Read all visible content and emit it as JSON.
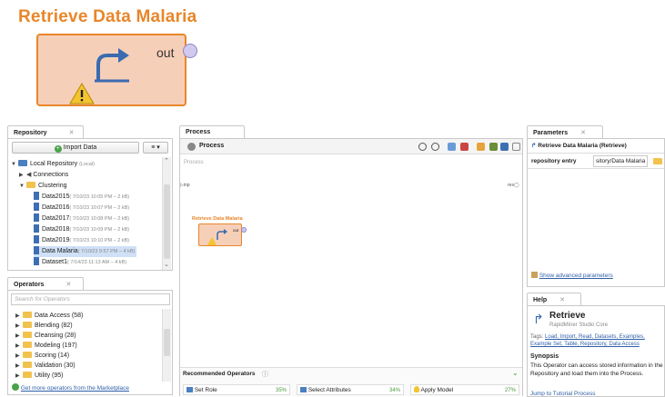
{
  "zoom": {
    "title": "Retrieve Data Malaria",
    "port_label": "out"
  },
  "repository": {
    "tab": "Repository",
    "import_button": "Import Data",
    "menu_button": "≡ ▾",
    "items": [
      {
        "label": "Local Repository",
        "meta": "(Local)",
        "kind": "root"
      },
      {
        "label": "Connections",
        "meta": "",
        "kind": "folder"
      },
      {
        "label": "Clustering",
        "meta": "",
        "kind": "folder"
      },
      {
        "label": "Data2015",
        "meta": "( 7/10/23 10:05 PM – 2 kB)",
        "kind": "data"
      },
      {
        "label": "Data2016",
        "meta": "( 7/10/23 10:07 PM – 2 kB)",
        "kind": "data"
      },
      {
        "label": "Data2017",
        "meta": "( 7/10/23 10:08 PM – 2 kB)",
        "kind": "data"
      },
      {
        "label": "Data2018",
        "meta": "( 7/10/23 10:09 PM – 2 kB)",
        "kind": "data"
      },
      {
        "label": "Data2019",
        "meta": "( 7/10/23 10:10 PM – 2 kB)",
        "kind": "data"
      },
      {
        "label": "Data Malaria",
        "meta": "( 7/10/23 9:57 PM – 4 kB)",
        "kind": "data"
      },
      {
        "label": "Dataset1",
        "meta": "( 7/14/23 11:13 AM – 4 kB)",
        "kind": "data"
      }
    ]
  },
  "operators": {
    "tab": "Operators",
    "search_placeholder": "Search for Operators",
    "items": [
      {
        "label": "Data Access (58)"
      },
      {
        "label": "Blending (82)"
      },
      {
        "label": "Cleansing (28)"
      },
      {
        "label": "Modeling (197)"
      },
      {
        "label": "Scoring (14)"
      },
      {
        "label": "Validation (30)"
      },
      {
        "label": "Utility (95)"
      }
    ],
    "marketplace_link": "Get more operators from the Marketplace"
  },
  "process": {
    "tab": "Process",
    "header": "Process",
    "breadcrumb": "Process",
    "port_in": "inp",
    "port_out": "res",
    "operator_title": "Retrieve Data Malaria",
    "operator_port": "out"
  },
  "recommended": {
    "title": "Recommended Operators",
    "items": [
      {
        "label": "Set Role",
        "pct": "35%"
      },
      {
        "label": "Select Attributes",
        "pct": "34%"
      },
      {
        "label": "Apply Model",
        "pct": "27%"
      }
    ]
  },
  "parameters": {
    "tab": "Parameters",
    "operator": "Retrieve Data Malaria (Retrieve)",
    "param_label": "repository entry",
    "param_value": "sitory/Data Malaria",
    "advanced_link": "Show advanced parameters"
  },
  "help": {
    "tab": "Help",
    "title": "Retrieve",
    "subtitle": "RapidMiner Studio Core",
    "tags_prefix": "Tags:",
    "tags": "Load, Import, Read, Datasets, Examples, Example Set, Table, Repository, Data Access",
    "synopsis_title": "Synopsis",
    "synopsis": "This Operator can access stored information in the Repository and load them into the Process.",
    "tutorial_link": "Jump to Tutorial Process"
  },
  "colors": {
    "operator_orange": "#e8862a",
    "operator_fill": "#f6cfb9",
    "link_blue": "#2f5fa8",
    "pct_green": "#4a9a3d"
  }
}
